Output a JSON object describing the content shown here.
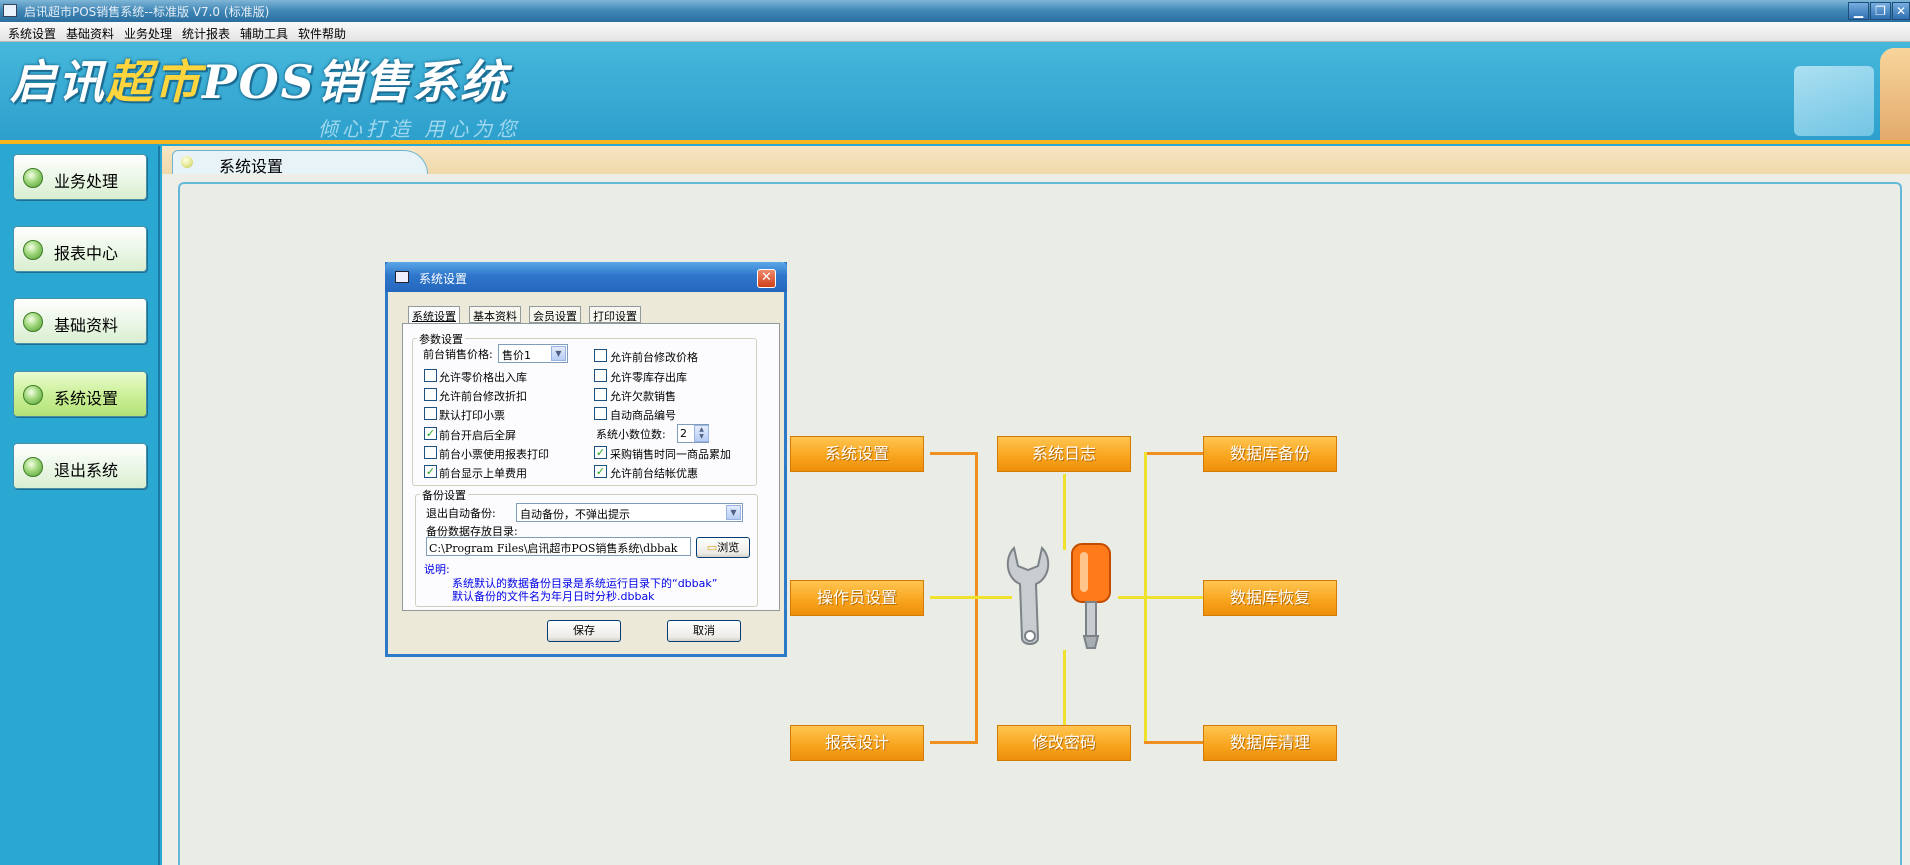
{
  "window": {
    "title": "启讯超市POS销售系统--标准版 V7.0 (标准版)",
    "minimize": "▁",
    "restore": "❐",
    "close": "✕"
  },
  "menu": [
    "系统设置",
    "基础资料",
    "业务处理",
    "统计报表",
    "辅助工具",
    "软件帮助"
  ],
  "banner": {
    "logo_part1": "启讯",
    "logo_part2": "超市",
    "logo_part3": "POS销售系统",
    "slogan": "倾心打造  用心为您"
  },
  "sidebar": {
    "items": [
      {
        "label": "业务处理"
      },
      {
        "label": "报表中心"
      },
      {
        "label": "基础资料"
      },
      {
        "label": "系统设置"
      },
      {
        "label": "退出系统"
      }
    ],
    "active_index": 3
  },
  "main": {
    "tab_title": "系统设置"
  },
  "functions": {
    "system_settings": "系统设置",
    "system_log": "系统日志",
    "db_backup": "数据库备份",
    "operator_settings": "操作员设置",
    "db_restore": "数据库恢复",
    "report_design": "报表设计",
    "change_password": "修改密码",
    "db_cleanup": "数据库清理"
  },
  "dialog": {
    "title": "系统设置",
    "close": "✕",
    "tabs": [
      "系统设置",
      "基本资料",
      "会员设置",
      "打印设置"
    ],
    "params": {
      "legend": "参数设置",
      "price_label": "前台销售价格:",
      "price_value": "售价1",
      "checkboxes": [
        {
          "label": "允许前台修改价格",
          "checked": false
        },
        {
          "label": "允许零价格出入库",
          "checked": false
        },
        {
          "label": "允许零库存出库",
          "checked": false
        },
        {
          "label": "允许前台修改折扣",
          "checked": false
        },
        {
          "label": "允许欠款销售",
          "checked": false
        },
        {
          "label": "默认打印小票",
          "checked": false
        },
        {
          "label": "自动商品编号",
          "checked": false
        },
        {
          "label": "前台开启后全屏",
          "checked": true
        },
        {
          "label": "前台小票使用报表打印",
          "checked": false
        },
        {
          "label": "采购销售时同一商品累加",
          "checked": true
        },
        {
          "label": "前台显示上单费用",
          "checked": true
        },
        {
          "label": "允许前台结帐优惠",
          "checked": true
        }
      ],
      "decimals_label": "系统小数位数:",
      "decimals_value": "2"
    },
    "backup": {
      "legend": "备份设置",
      "auto_label": "退出自动备份:",
      "auto_value": "自动备份，不弹出提示",
      "dir_label": "备份数据存放目录:",
      "dir_value": "C:\\Program Files\\启讯超市POS销售系统\\dbbak",
      "browse": "浏览",
      "note_title": "说明:",
      "note_line1": "系统默认的数据备份目录是系统运行目录下的“dbbak”",
      "note_line2": "默认备份的文件名为年月日时分秒.dbbak"
    },
    "save": "保存",
    "cancel": "取消"
  }
}
